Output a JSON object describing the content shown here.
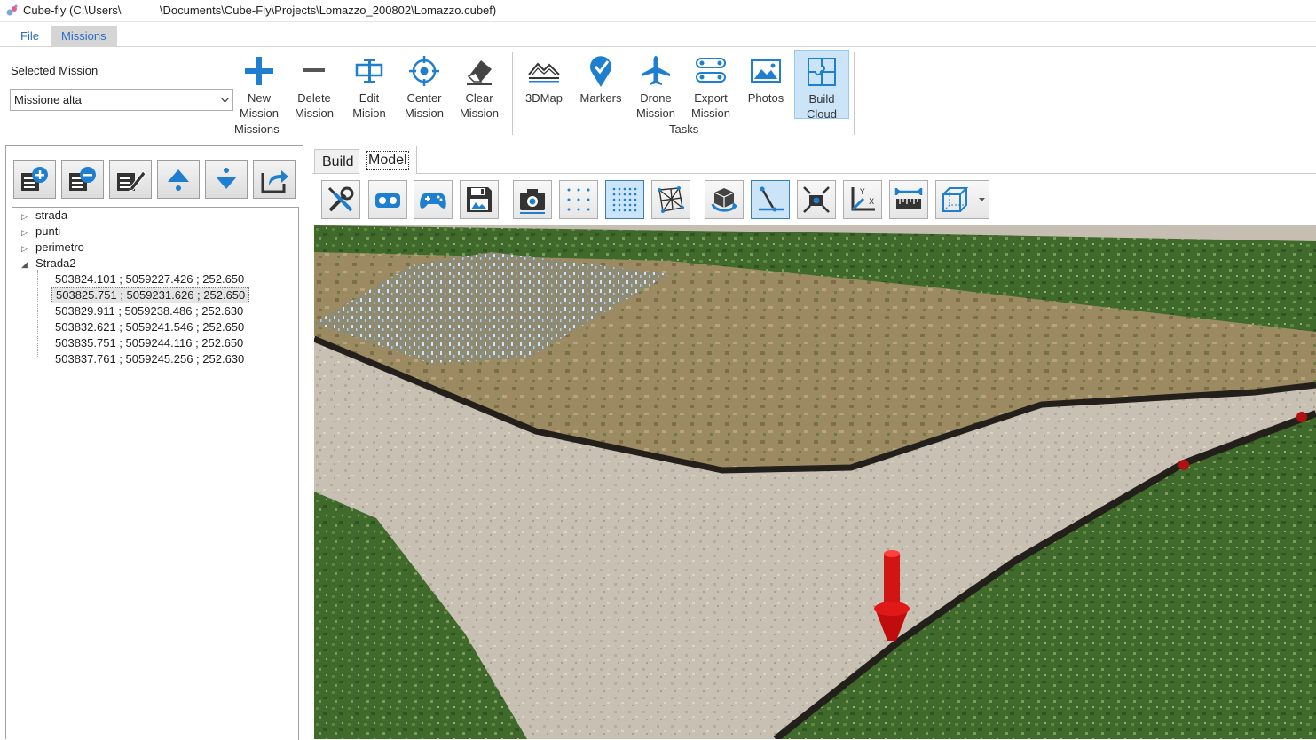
{
  "window": {
    "title": "Cube-fly (C:\\Users\\            \\Documents\\Cube-Fly\\Projects\\Lomazzo_200802\\Lomazzo.cubef)"
  },
  "menu": {
    "file": "File",
    "missions": "Missions"
  },
  "ribbon": {
    "selected_mission_label": "Selected Mission",
    "selected_mission_value": "Missione alta",
    "missions_group_label": "Missions",
    "tasks_group_label": "Tasks",
    "missions_buttons": [
      {
        "label": "New\nMission",
        "icon": "plus-icon"
      },
      {
        "label": "Delete\nMission",
        "icon": "minus-icon"
      },
      {
        "label": "Edit\nMision",
        "icon": "edit-mission-icon"
      },
      {
        "label": "Center\nMission",
        "icon": "crosshair-icon"
      },
      {
        "label": "Clear\nMission",
        "icon": "eraser-icon"
      }
    ],
    "tasks_buttons": [
      {
        "label": "3DMap",
        "icon": "terrain-icon"
      },
      {
        "label": "Markers",
        "icon": "map-marker-icon"
      },
      {
        "label": "Drone\nMission",
        "icon": "airplane-icon"
      },
      {
        "label": "Export\nMission",
        "icon": "route-export-icon"
      },
      {
        "label": "Photos",
        "icon": "photo-icon"
      },
      {
        "label": "Build\nCloud",
        "icon": "puzzle-icon",
        "active": true
      }
    ]
  },
  "left_toolbar": [
    "add-item-icon",
    "remove-item-icon",
    "edit-item-icon",
    "move-up-icon",
    "move-down-icon",
    "export-icon"
  ],
  "tree": {
    "nodes": [
      {
        "label": "strada",
        "expanded": false
      },
      {
        "label": "punti",
        "expanded": false
      },
      {
        "label": "perimetro",
        "expanded": false
      },
      {
        "label": "Strada2",
        "expanded": true
      }
    ],
    "children": [
      "503824.101 ; 5059227.426 ; 252.650",
      "503825.751 ; 5059231.626 ; 252.650",
      "503829.911 ; 5059238.486 ; 252.630",
      "503832.621 ; 5059241.546 ; 252.650",
      "503835.751 ; 5059244.116 ; 252.650",
      "503837.761 ; 5059245.256 ; 252.630"
    ],
    "selected_index": 1
  },
  "view_tabs": {
    "build": "Build",
    "model": "Model",
    "active": "Model"
  },
  "view_toolbar": [
    "tools-icon",
    "vr-headset-icon",
    "gamepad-icon",
    "save-image-icon",
    "camera-icon",
    "sparse-points-icon",
    "dense-points-icon",
    "mesh-icon",
    "rotate-cube-icon",
    "measure-line-icon",
    "camera-focus-icon",
    "axes-icon",
    "ruler-icon",
    "bounding-box-icon"
  ],
  "colors": {
    "accent": "#1e7fd0",
    "menu_text": "#2b6cc4",
    "active_button": "#cce4f7"
  }
}
